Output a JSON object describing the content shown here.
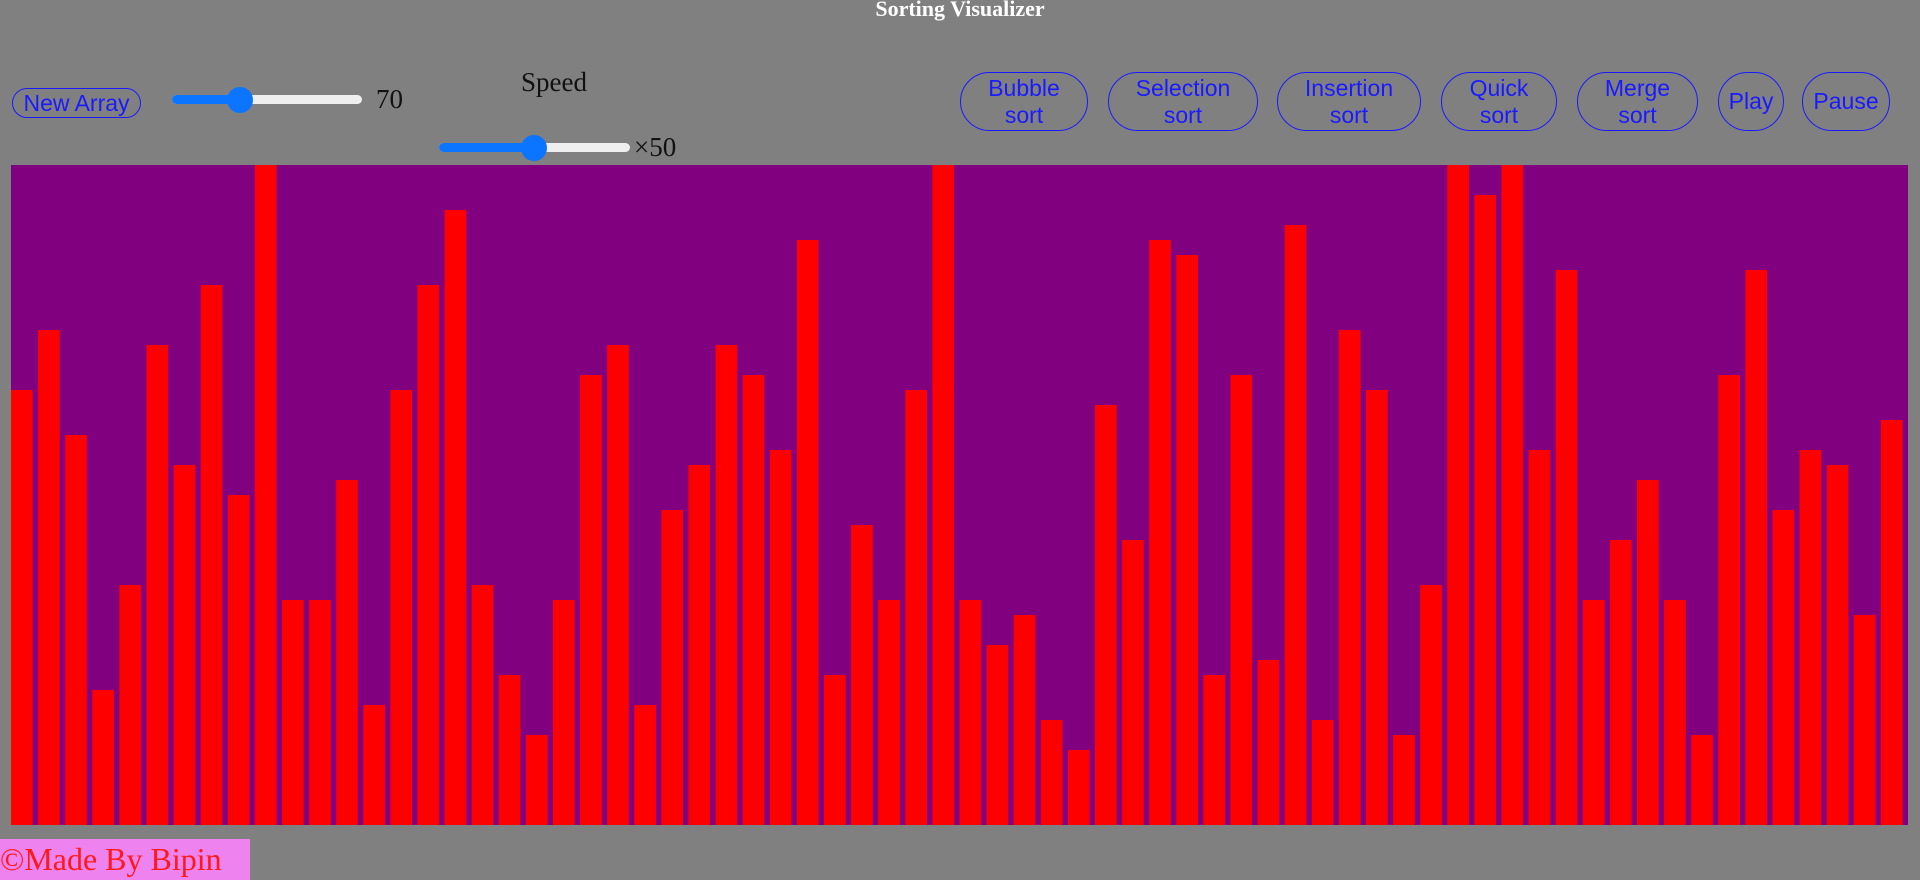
{
  "header": {
    "title": "Sorting Visualizer"
  },
  "controls": {
    "new_array_label": "New Array",
    "array_size": {
      "value": 70,
      "min": 5,
      "max": 200,
      "display": "70"
    },
    "speed": {
      "label": "Speed",
      "value": 50,
      "min": 1,
      "max": 100,
      "display": "×50"
    }
  },
  "sort_buttons": [
    {
      "line1": "Bubble",
      "line2": "sort"
    },
    {
      "line1": "Selection",
      "line2": "sort"
    },
    {
      "line1": "Insertion",
      "line2": "sort"
    },
    {
      "line1": "Quick",
      "line2": "sort"
    },
    {
      "line1": "Merge",
      "line2": "sort"
    }
  ],
  "playback": {
    "play_label": "Play",
    "pause_label": "Pause"
  },
  "colors": {
    "background": "#808080",
    "array_bg": "#800080",
    "bar": "#ff0000",
    "accent": "#0b75ff",
    "button_text": "#1a1aff"
  },
  "chart_data": {
    "type": "bar",
    "max_value": 44,
    "values": [
      29,
      33,
      26,
      9,
      16,
      32,
      24,
      36,
      22,
      44,
      15,
      15,
      23,
      8,
      29,
      36,
      41,
      16,
      10,
      6,
      15,
      30,
      32,
      8,
      21,
      24,
      32,
      30,
      25,
      39,
      10,
      20,
      15,
      29,
      44,
      15,
      12,
      14,
      7,
      5,
      28,
      19,
      39,
      38,
      10,
      30,
      11,
      40,
      7,
      33,
      29,
      6,
      16,
      44,
      42,
      44,
      25,
      37,
      15,
      19,
      23,
      15,
      6,
      30,
      37,
      21,
      25,
      24,
      14,
      27
    ]
  },
  "footer": {
    "text": "©Made By Bipin"
  }
}
